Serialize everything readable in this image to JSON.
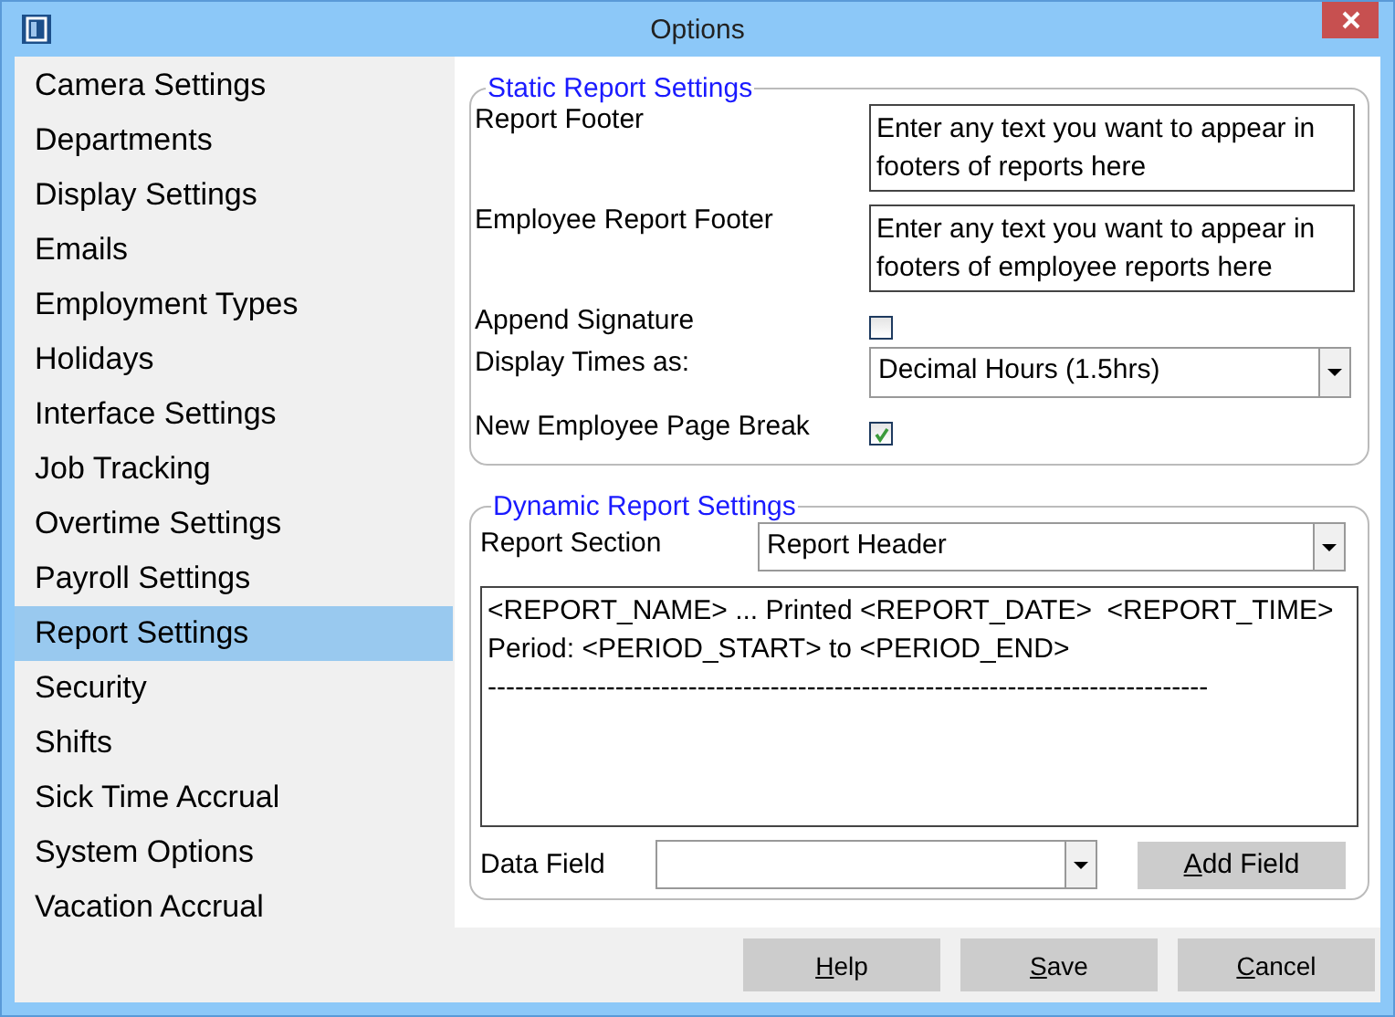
{
  "window": {
    "title": "Options"
  },
  "sidebar": {
    "items": [
      {
        "label": "Camera Settings",
        "selected": false
      },
      {
        "label": "Departments",
        "selected": false
      },
      {
        "label": "Display Settings",
        "selected": false
      },
      {
        "label": "Emails",
        "selected": false
      },
      {
        "label": "Employment Types",
        "selected": false
      },
      {
        "label": "Holidays",
        "selected": false
      },
      {
        "label": "Interface Settings",
        "selected": false
      },
      {
        "label": "Job Tracking",
        "selected": false
      },
      {
        "label": "Overtime Settings",
        "selected": false
      },
      {
        "label": "Payroll Settings",
        "selected": false
      },
      {
        "label": "Report Settings",
        "selected": true
      },
      {
        "label": "Security",
        "selected": false
      },
      {
        "label": "Shifts",
        "selected": false
      },
      {
        "label": "Sick Time Accrual",
        "selected": false
      },
      {
        "label": "System Options",
        "selected": false
      },
      {
        "label": "Vacation Accrual",
        "selected": false
      }
    ]
  },
  "static_group": {
    "title": "Static Report Settings",
    "rows": [
      {
        "kind": "textarea",
        "label": "Report Footer",
        "placeholder": "Enter any text you want to appear in footers of reports here"
      },
      {
        "kind": "textarea",
        "label": "Employee Report Footer",
        "placeholder": "Enter any text you want to appear in footers of employee reports here"
      },
      {
        "kind": "checkbox",
        "label": "Append Signature",
        "checked": false
      },
      {
        "kind": "select",
        "label": "Display Times as:",
        "value": "Decimal Hours (1.5hrs)"
      },
      {
        "kind": "checkbox",
        "label": "New Employee Page Break",
        "checked": true
      }
    ]
  },
  "dynamic_group": {
    "title": "Dynamic Report Settings",
    "report_section": {
      "label": "Report Section",
      "value": "Report Header"
    },
    "template_lines": [
      "<REPORT_NAME> ... Printed <REPORT_DATE>  <REPORT_TIME>",
      "Period: <PERIOD_START> to <PERIOD_END>",
      "-------------------------------------------------------------------------------"
    ],
    "data_field": {
      "label": "Data Field"
    },
    "add_button": {
      "mnemonic": "A",
      "rest": "dd Field"
    }
  },
  "buttons": [
    {
      "mnemonic": "H",
      "rest": "elp"
    },
    {
      "mnemonic": "S",
      "rest": "ave"
    },
    {
      "mnemonic": "C",
      "rest": "ancel"
    }
  ]
}
